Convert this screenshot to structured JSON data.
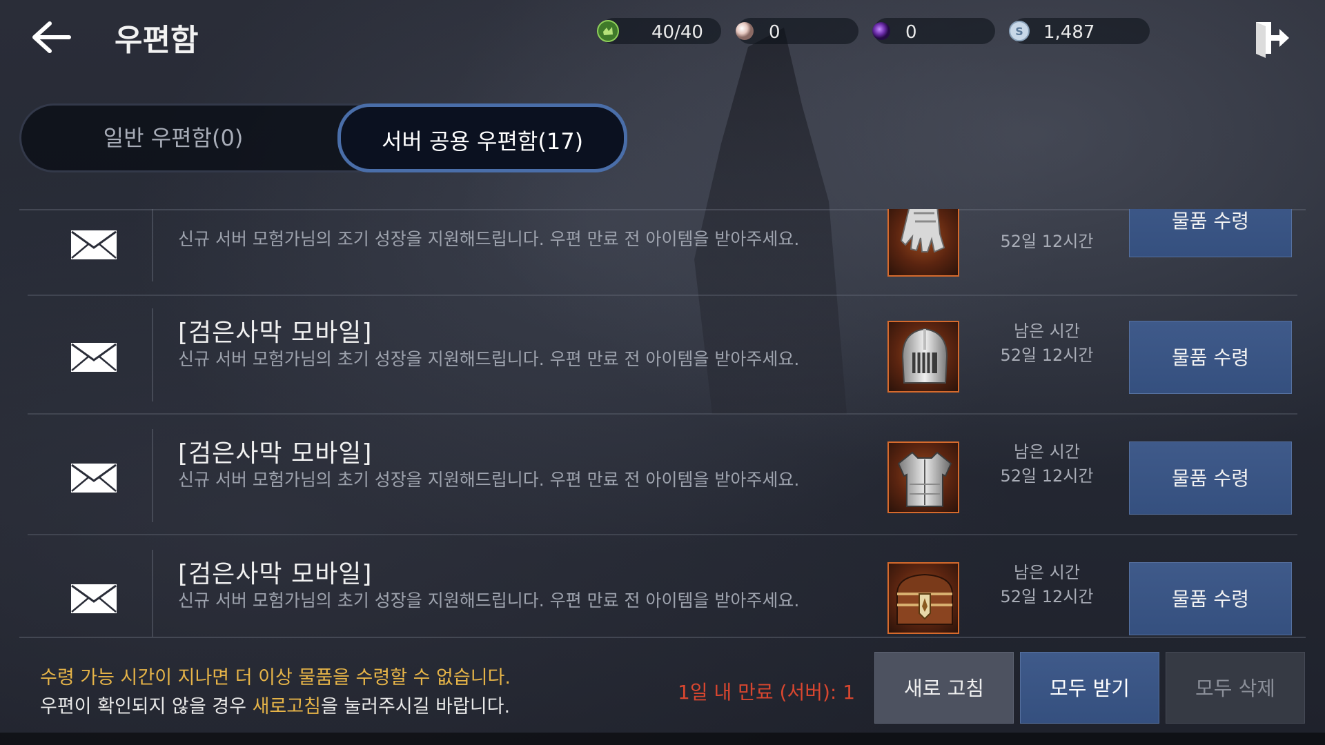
{
  "header": {
    "title": "우편함",
    "currencies": [
      {
        "name": "stamina-icon",
        "value": "40/40",
        "color": "#5a9a3a"
      },
      {
        "name": "pearl-icon",
        "value": "0",
        "color": "#e6c8c0"
      },
      {
        "name": "purple-gem-icon",
        "value": "0",
        "color": "#6a2ca8"
      },
      {
        "name": "silver-coin-icon",
        "value": "1,487",
        "color": "#c8d8e8"
      }
    ]
  },
  "tabs": {
    "general": "일반 우편함(0)",
    "server": "서버 공용 우편함(17)"
  },
  "mails": [
    {
      "title": "",
      "desc": "신규 서버 모험가님의 조기 성장을 지원해드립니다. 우편 만료 전 아이템을 받아주세요.",
      "item": "gauntlet-icon",
      "remain_label": "",
      "remain_time": "52일 12시간",
      "button": "물품 수령"
    },
    {
      "title": "[검은사막 모바일]",
      "desc": "신규 서버 모험가님의 초기 성장을 지원해드립니다. 우편 만료 전 아이템을 받아주세요.",
      "item": "helmet-icon",
      "remain_label": "남은 시간",
      "remain_time": "52일 12시간",
      "button": "물품 수령"
    },
    {
      "title": "[검은사막 모바일]",
      "desc": "신규 서버 모험가님의 초기 성장을 지원해드립니다. 우편 만료 전 아이템을 받아주세요.",
      "item": "armor-icon",
      "remain_label": "남은 시간",
      "remain_time": "52일 12시간",
      "button": "물품 수령"
    },
    {
      "title": "[검은사막 모바일]",
      "desc": "신규 서버 모험가님의 초기 성장을 지원해드립니다. 우편 만료 전 아이템을 받아주세요.",
      "item": "treasure-chest-icon",
      "remain_label": "남은 시간",
      "remain_time": "52일 12시간",
      "button": "물품 수령"
    }
  ],
  "footer": {
    "notice_line1": "수령 가능 시간이 지나면 더 이상 물품을 수령할 수 없습니다.",
    "notice_line2_pre": "우편이 확인되지 않을 경우 ",
    "notice_line2_highlight": "새로고침",
    "notice_line2_post": "을 눌러주시길 바랍니다.",
    "expire_text": "1일 내 만료 (서버): 1",
    "refresh_label": "새로 고침",
    "claim_all_label": "모두 받기",
    "delete_all_label": "모두 삭제"
  }
}
